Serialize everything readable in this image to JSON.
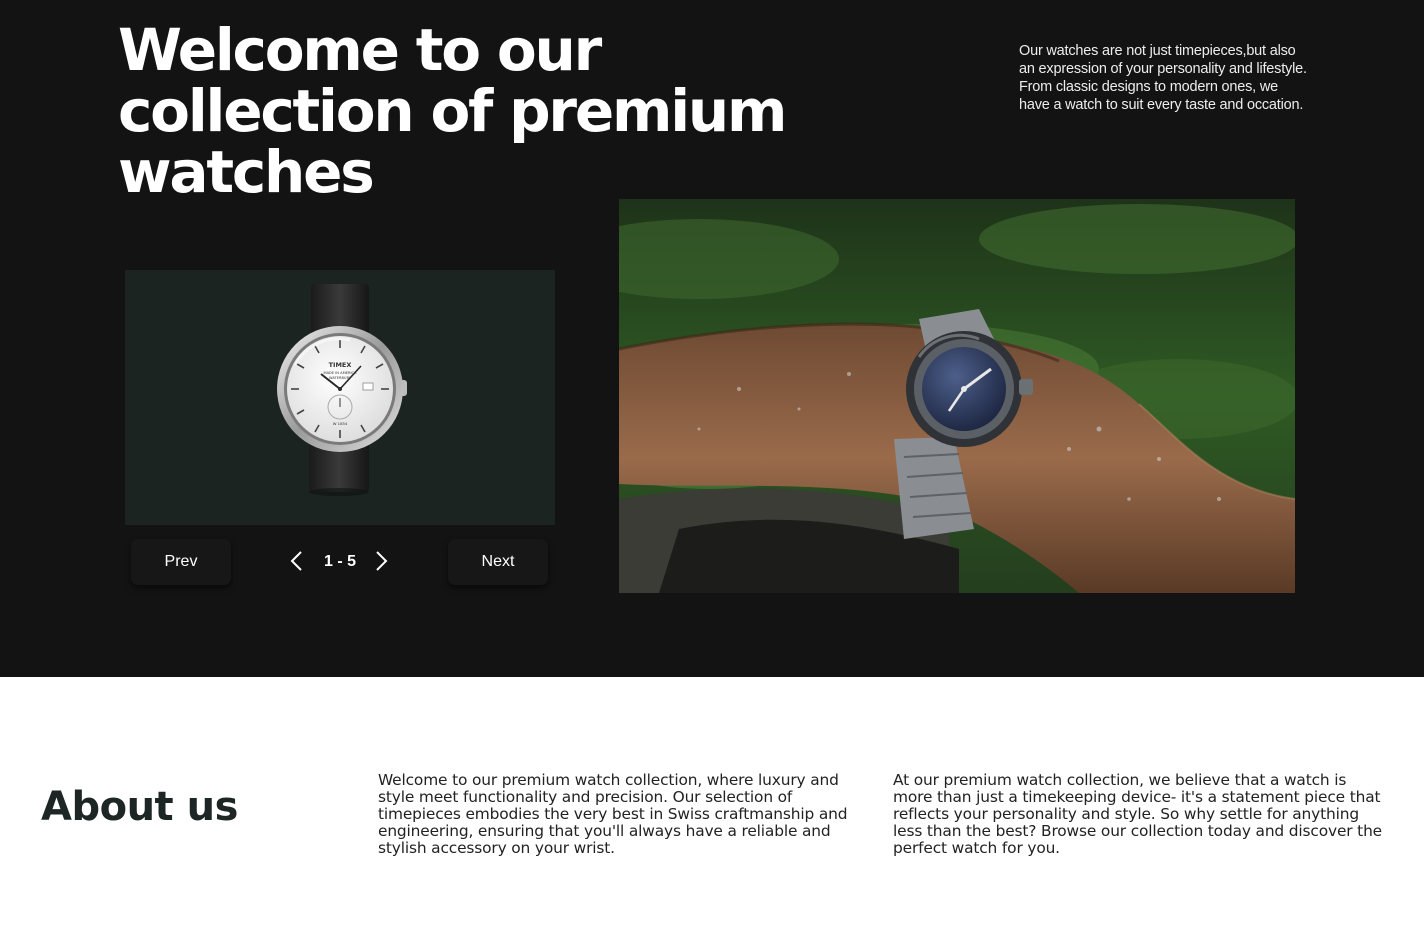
{
  "hero": {
    "title": "Welcome to our collection of premium watches",
    "description": "Our watches are not just timepieces,but also an expression of your personality and lifestyle. From classic designs to modern ones, we have a watch to suit every taste and occation."
  },
  "carousel": {
    "prev_label": "Prev",
    "next_label": "Next",
    "pager": "1 - 5",
    "product_watch_text": {
      "brand": "TIMEX",
      "line1": "MADE IN AMERICA",
      "line2": "WATERBURY",
      "bottom": "W 1854"
    }
  },
  "about": {
    "title": "About us",
    "col1": "Welcome to our premium watch collection, where luxury and style meet functionality and precision. Our selection of timepieces embodies the very best in Swiss craftmanship and engineering, ensuring that you'll always have a reliable and stylish accessory on your wrist.",
    "col2": "At our premium watch collection, we believe that a watch is more than just a timekeeping device- it's a statement piece that reflects your personality and style. So why settle for anything less than the best? Browse our collection today and discover the perfect watch for you."
  },
  "colors": {
    "hero_bg": "#131313",
    "card_bg": "#1c2421",
    "button_bg": "#171717",
    "text_light": "#ffffff",
    "text_dark": "#1d2624"
  }
}
